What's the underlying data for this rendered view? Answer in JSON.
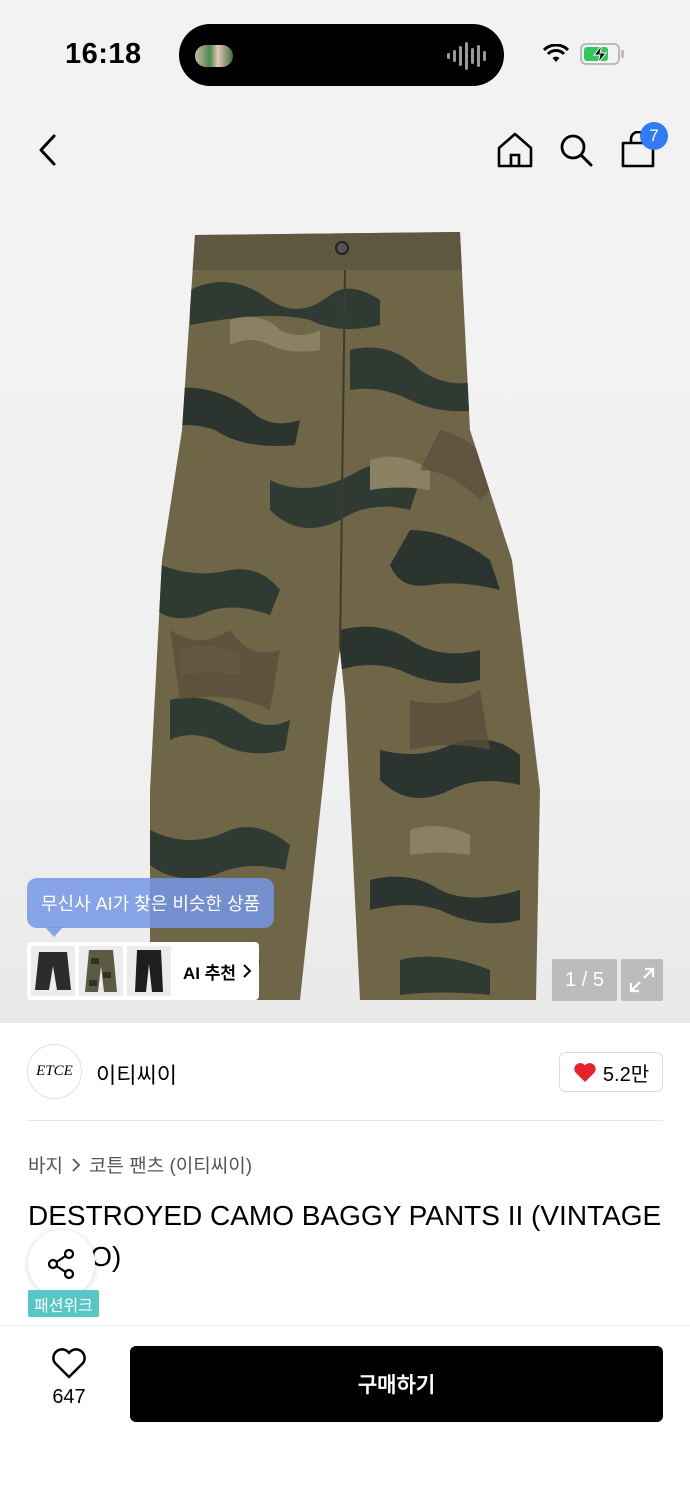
{
  "status_bar": {
    "time": "16:18"
  },
  "header": {
    "cart_count": "7"
  },
  "image": {
    "ai_tooltip": "무신사 AI가 찾은 비슷한 상품",
    "ai_recommend_label": "AI 추천",
    "counter": "1 / 5"
  },
  "brand": {
    "logo_text": "ETCE",
    "name": "이티씨이",
    "likes": "5.2만"
  },
  "breadcrumb": {
    "category": "바지",
    "subcategory": "코튼 팬츠 (이티씨이)"
  },
  "product": {
    "title": "DESTROYED CAMO BAGGY PANTS II (VINTAGE CAMO)",
    "tag": "패션위크"
  },
  "bottom": {
    "like_count": "647",
    "buy_label": "구매하기"
  },
  "colors": {
    "accent_blue": "#2f7cf6",
    "like_red": "#e8212b",
    "tag_teal": "#58c6c6",
    "tooltip_blue": "#7696e6"
  }
}
